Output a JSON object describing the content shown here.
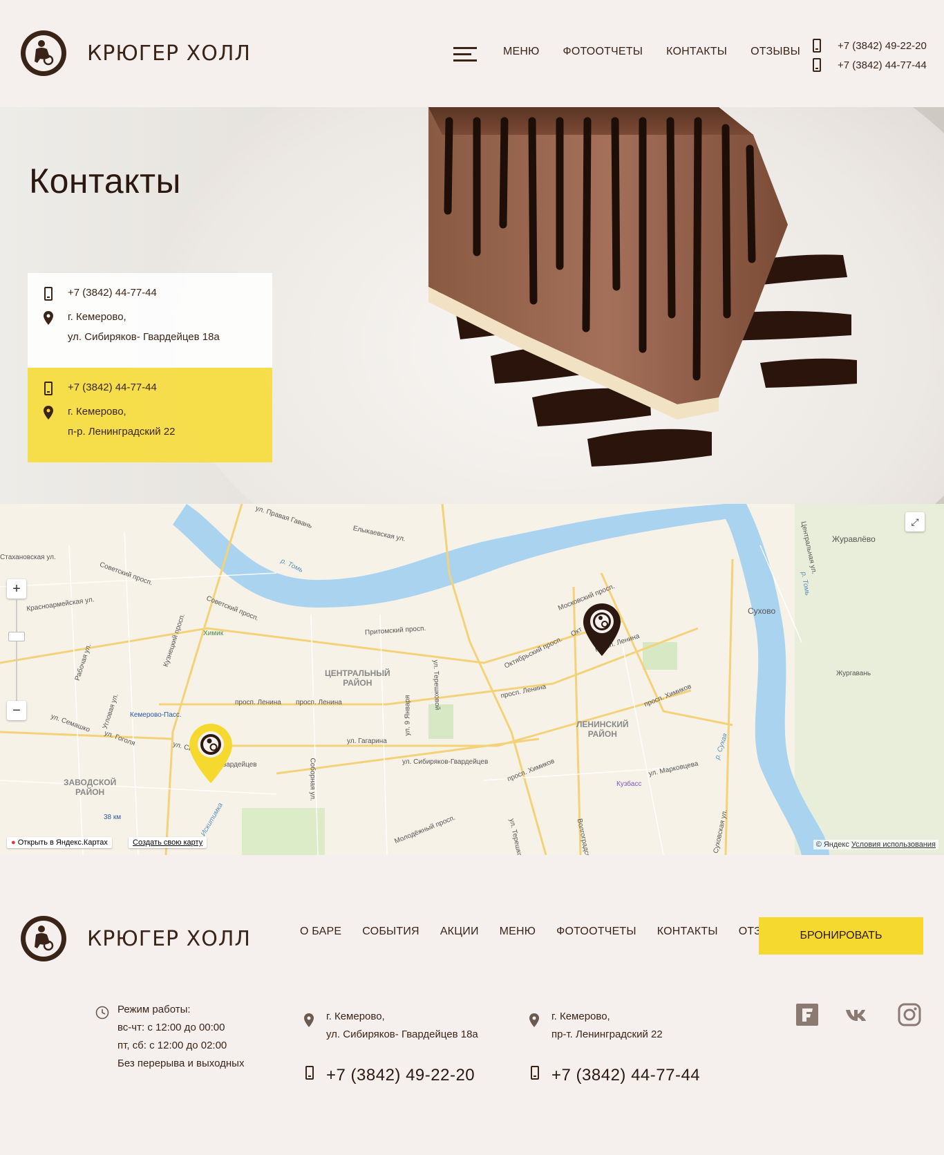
{
  "brand": {
    "name": "КРЮГЕР ХОЛЛ"
  },
  "header": {
    "nav": [
      "МЕНЮ",
      "ФОТООТЧЕТЫ",
      "КОНТАКТЫ",
      "ОТЗЫВЫ"
    ],
    "phones": [
      "+7 (3842) 49-22-20",
      "+7 (3842) 44-77-44"
    ]
  },
  "hero": {
    "title": "Контакты",
    "cards": [
      {
        "phone": "+7 (3842) 44-77-44",
        "city": "г. Кемерово,",
        "street": "ул. Сибиряков- Гвардейцев 18а"
      },
      {
        "phone": "+7 (3842) 44-77-44",
        "city": "г. Кемерово,",
        "street": "п-р. Ленинградский 22"
      }
    ]
  },
  "map": {
    "labels": {
      "pravaya_gavan": "ул. Правая Гавань",
      "elykaevskaya": "Елыкаевская ул.",
      "tom1": "р. Томь",
      "tom2": "р. Томь",
      "stakhanovskaya": "Стахановская ул.",
      "sovetsky1": "Советский просп.",
      "sovetsky2": "Советский просп.",
      "krasnoarm": "Красноармейская ул.",
      "khimik": "Химик",
      "pritomsky": "Притомский просп.",
      "tereshkovoy1": "ул. Терешковой",
      "tereshkovoy2": "ул. Терешкова",
      "moskovsky": "Московский просп.",
      "oktyabrsky1": "Октябрьский просп.",
      "oktyabrsky2": "Окт",
      "lenina1": "просп. Ленина",
      "lenina2": "просп. Ленина",
      "lenina3": "просп. Ленина",
      "lenina4": "просп. Ленина",
      "tsentralny": "ЦЕНТРАЛЬНЫЙ\nРАЙОН",
      "leninsky": "ЛЕНИНСКИЙ\nРАЙОН",
      "zavodskoy": "ЗАВОДСКОЙ\nРАЙОН",
      "kuznetsky": "Кузнецкий просп.",
      "rabochaya": "Рабочая ул.",
      "uglovaya": "Угловая ул.",
      "kemerovo_pass": "Кемерово-Пасс.",
      "semashko": "ул. Семашко",
      "gogolya": "ул. Гоголя",
      "sobornaya": "Соборная ул.",
      "yanvarya": "ул. 9 Января",
      "gagarina": "ул. Гагарина",
      "sib_gv": "ул. Сибиряков-Гвардейцев",
      "gvardeytsev": "вардейцев",
      "usi": "ул. Си",
      "khimikov1": "просп. Химиков",
      "khimikov2": "просп. Химиков",
      "markovtseva": "ул. Марковцева",
      "kuzbass": "Кузбасс",
      "sukhaya": "р. Сухая",
      "sukhovskaya": "Суховская ул.",
      "volgogradskaya": "Волгоградская",
      "molodezhny": "Молодёжный просп.",
      "km38": "38 км",
      "tsentralnaya": "Центральная ул.",
      "zhuravlevo": "Журавлёво",
      "sukhovo": "Сухово",
      "zhurgavan": "Жургавань",
      "iskitimka": "р. Искитимка"
    },
    "open_yandex": "Открыть в Яндекс.Картах",
    "create_map": "Создать свою карту",
    "copyright": "© Яндекс",
    "terms": "Условия использования",
    "zoom_in": "+",
    "zoom_out": "−"
  },
  "footer": {
    "nav": [
      "О БАРЕ",
      "СОБЫТИЯ",
      "АКЦИИ",
      "МЕНЮ",
      "ФОТООТЧЕТЫ",
      "КОНТАКТЫ",
      "ОТЗЫВЫ"
    ],
    "book": "БРОНИРОВАТЬ",
    "hours": [
      "Режим работы:",
      "вс-чт: с 12:00 до 00:00",
      "пт, сб: с 12:00 до 02:00",
      "Без перерыва и выходных"
    ],
    "addr1": {
      "city": "г. Кемерово,",
      "street": "ул. Сибиряков- Гвардейцев 18а",
      "phone": "+7 (3842) 49-22-20"
    },
    "addr2": {
      "city": "г. Кемерово,",
      "street": "пр-т. Ленинградский 22",
      "phone": "+7 (3842) 44-77-44"
    }
  },
  "colors": {
    "accent": "#f5d92f",
    "brown": "#3a2418",
    "bg": "#f5f0ed"
  },
  "icons": [
    "logo-icon",
    "burger-menu-icon",
    "phone-icon",
    "location-pin-icon",
    "clock-icon",
    "foursquare-icon",
    "vk-icon",
    "instagram-icon",
    "expand-icon",
    "map-marker-icon"
  ]
}
